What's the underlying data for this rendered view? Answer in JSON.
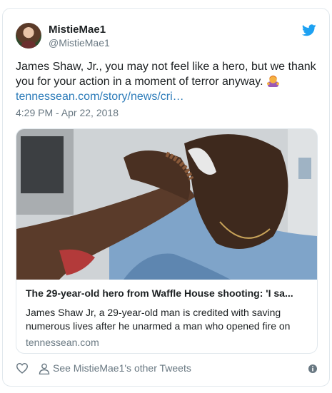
{
  "author": {
    "display_name": "MistieMae1",
    "handle": "@MistieMae1"
  },
  "tweet": {
    "text": "James Shaw, Jr., you may not feel like a hero, but we thank you for your action in a moment of terror anyway.",
    "emoji": "woman-bowing-emoji",
    "link": "tennessean.com/story/news/cri…",
    "timestamp": "4:29 PM - Apr 22, 2018"
  },
  "card": {
    "title": "The 29-year-old hero from Waffle House shooting: 'I sa...",
    "description": "James Shaw Jr, a 29-year-old man is credited with saving numerous lives after he unarmed a man who opened fire on",
    "domain": "tennessean.com"
  },
  "actions": {
    "other_tweets_label": "See MistieMae1's other Tweets"
  },
  "colors": {
    "link": "#2b7bb9",
    "muted": "#697882",
    "twitter_blue": "#1da1f2",
    "border": "#e1e8ed"
  },
  "icons": [
    "twitter-bird-icon",
    "heart-icon",
    "person-icon",
    "info-icon"
  ]
}
